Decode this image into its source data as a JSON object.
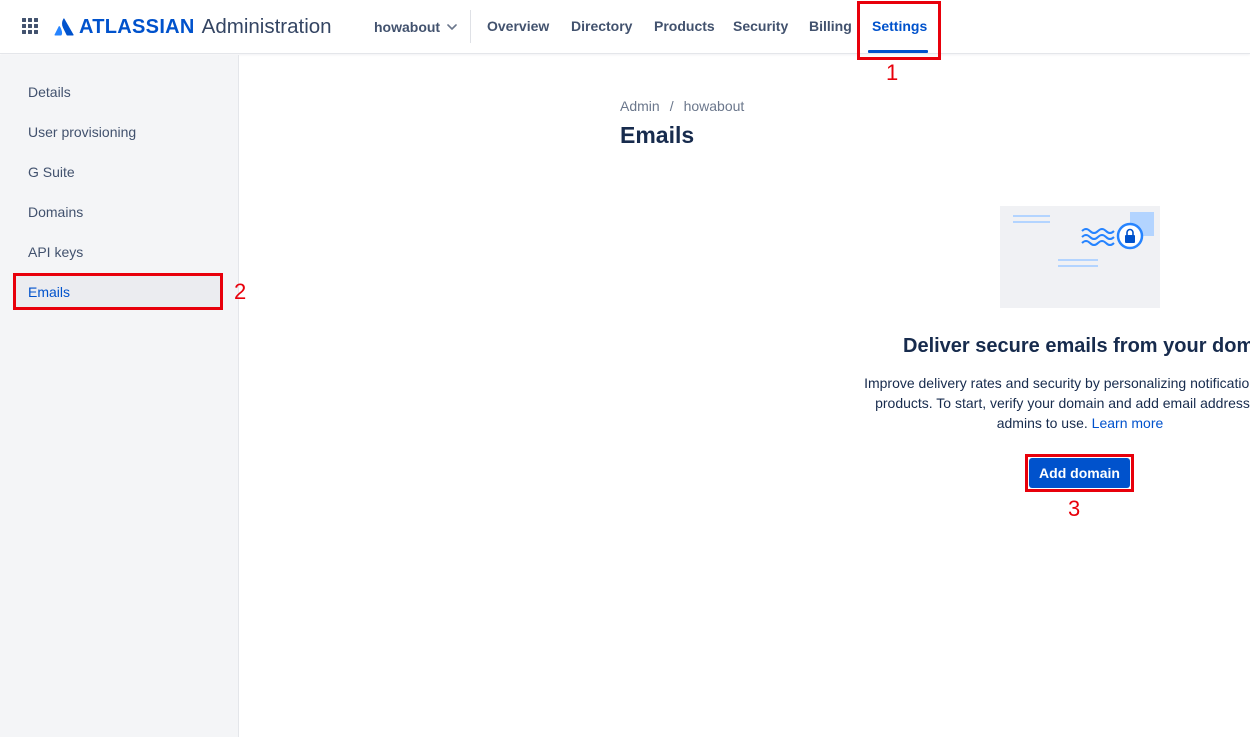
{
  "header": {
    "brand": "ATLASSIAN",
    "product": "Administration",
    "org_name": "howabout",
    "nav": [
      {
        "label": "Overview"
      },
      {
        "label": "Directory"
      },
      {
        "label": "Products"
      },
      {
        "label": "Security"
      },
      {
        "label": "Billing"
      },
      {
        "label": "Settings",
        "active": true
      }
    ]
  },
  "sidebar": {
    "items": [
      {
        "label": "Details"
      },
      {
        "label": "User provisioning"
      },
      {
        "label": "G Suite"
      },
      {
        "label": "Domains"
      },
      {
        "label": "API keys"
      },
      {
        "label": "Emails",
        "active": true
      }
    ]
  },
  "main": {
    "breadcrumb": [
      "Admin",
      "howabout"
    ],
    "breadcrumb_sep": "/",
    "title": "Emails",
    "empty_state": {
      "heading": "Deliver secure emails from your domain",
      "description_line1": "Improve delivery rates and security by personalizing notifications from",
      "description_line2": "products. To start, verify your domain and add email addresses for",
      "description_line3": "admins to use.",
      "learn_more": "Learn more",
      "button": "Add domain"
    }
  },
  "annotations": [
    "1",
    "2",
    "3"
  ],
  "colors": {
    "brand_blue": "#0052cc",
    "annotation_red": "#e8000b",
    "sidebar_bg": "#f4f5f7"
  }
}
